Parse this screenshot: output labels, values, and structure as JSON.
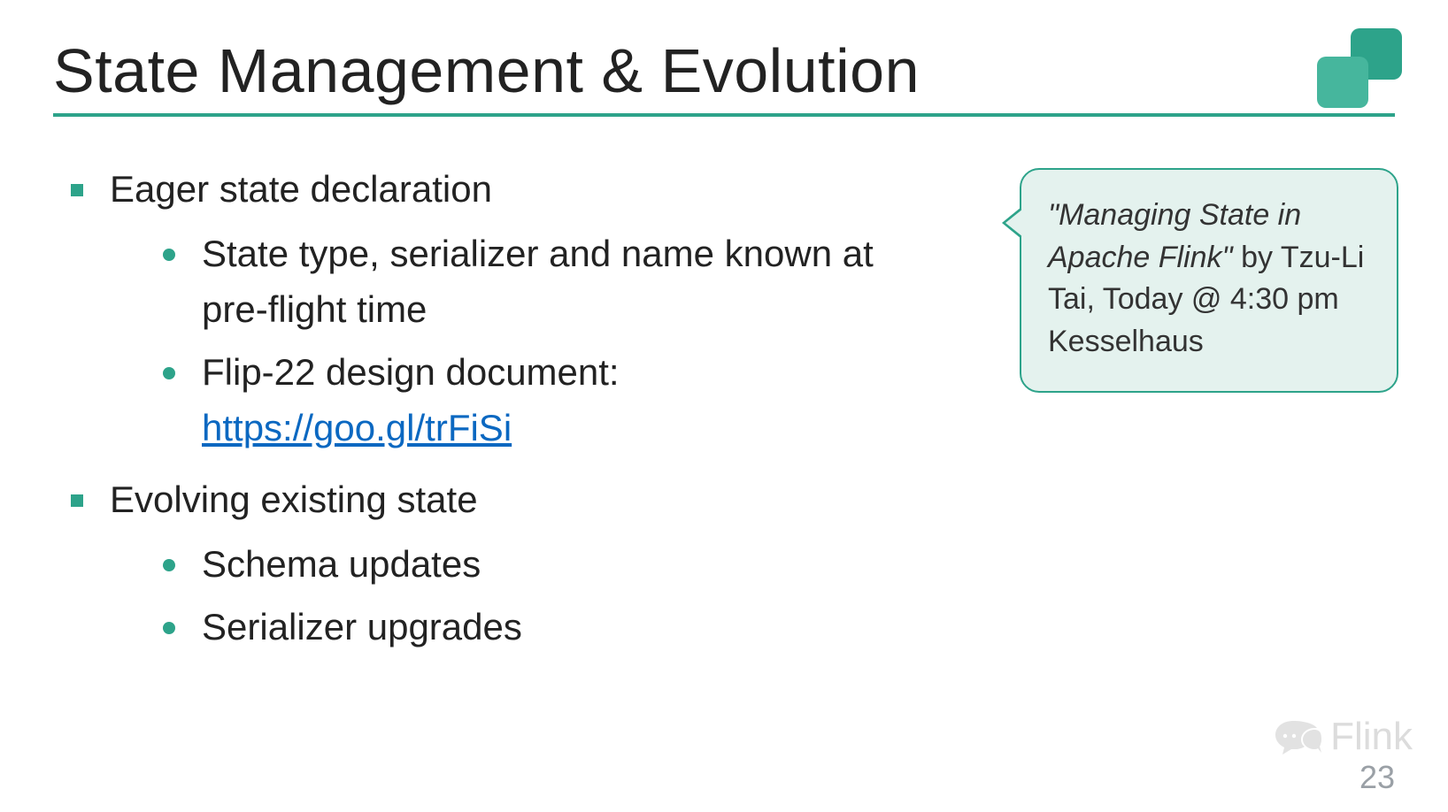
{
  "title": "State Management & Evolution",
  "bullets": [
    {
      "text": "Eager state declaration",
      "sub": [
        {
          "text": "State type, serializer and name known at pre-flight time"
        },
        {
          "prefix": "Flip-22 design document: ",
          "link_text": "https://goo.gl/trFiSi",
          "link_href": "https://goo.gl/trFiSi"
        }
      ]
    },
    {
      "text": "Evolving existing state",
      "sub": [
        {
          "text": "Schema updates"
        },
        {
          "text": "Serializer upgrades"
        }
      ]
    }
  ],
  "callout": {
    "talk_title": "\"Managing State in Apache Flink\"",
    "rest": " by Tzu-Li Tai, Today @ 4:30 pm Kesselhaus"
  },
  "watermark": "Flink",
  "page_number": "23"
}
